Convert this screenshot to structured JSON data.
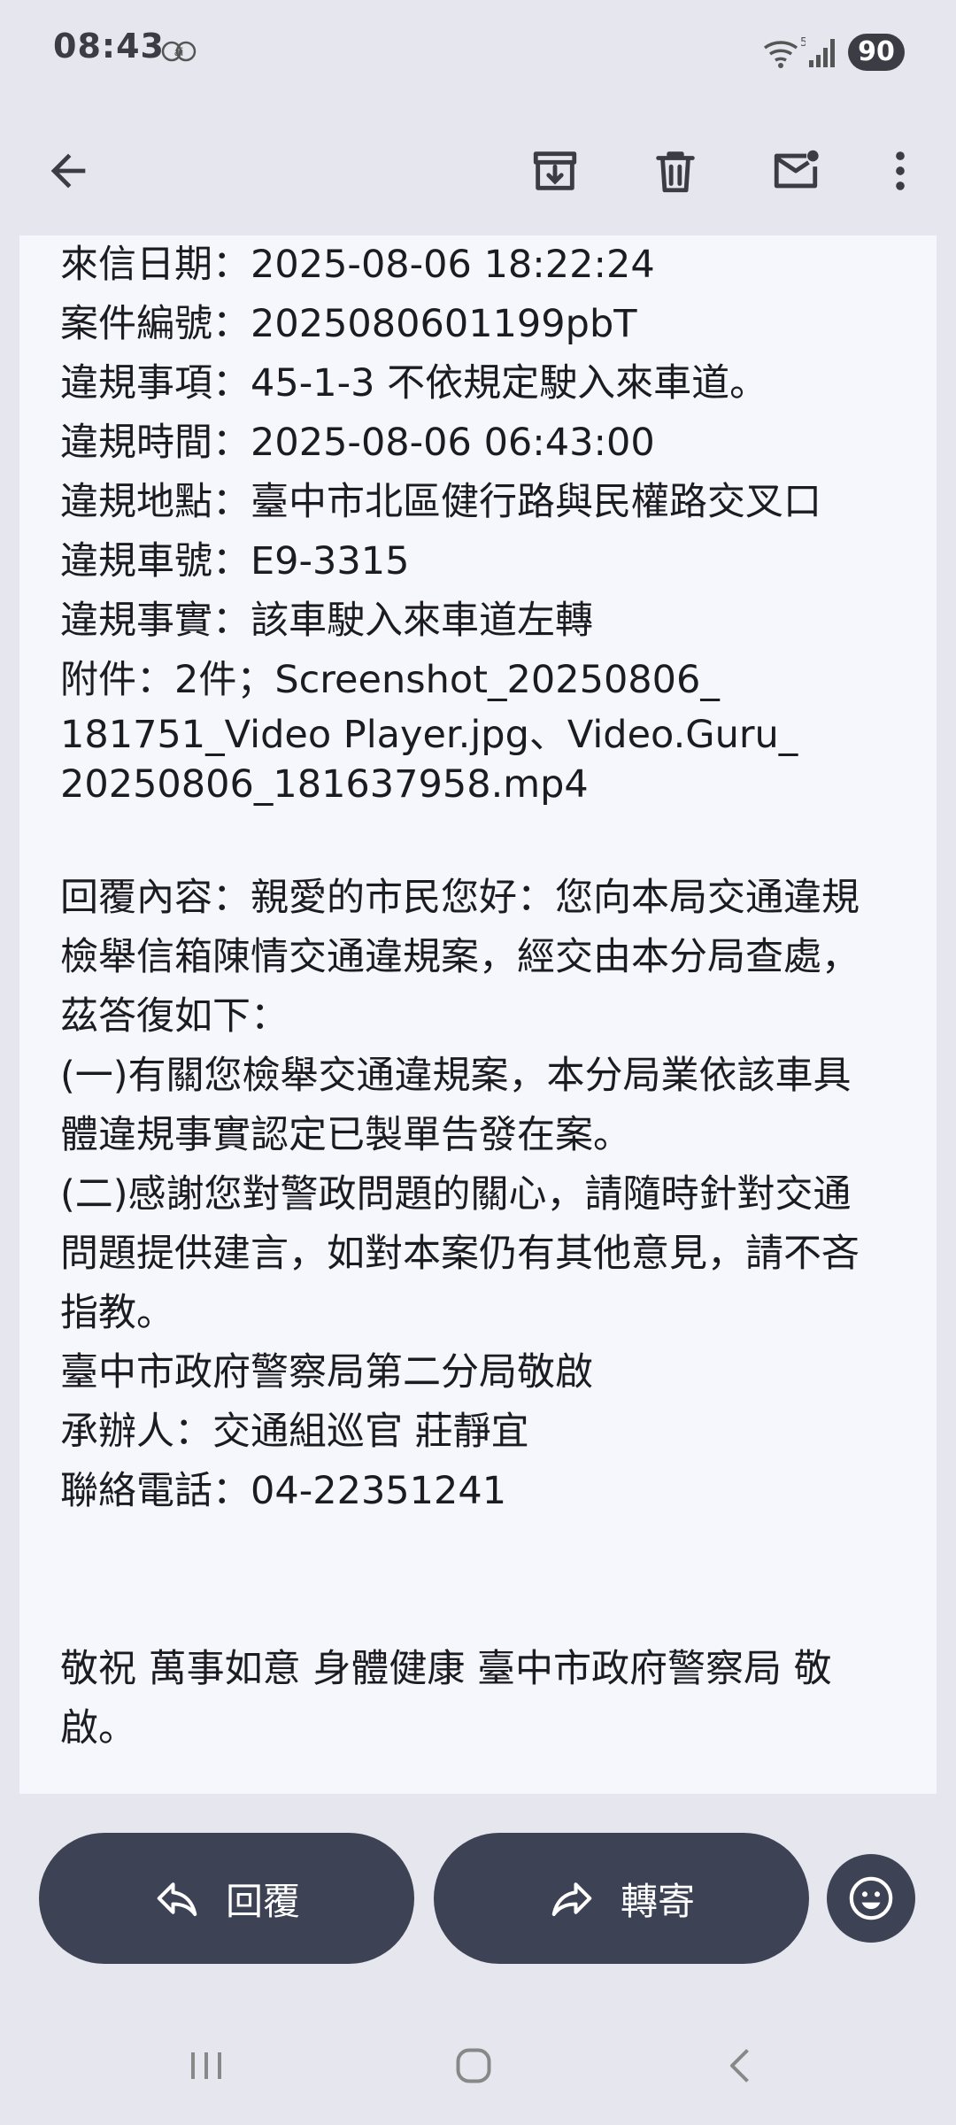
{
  "status": {
    "time": "08:43",
    "battery": "90",
    "wifi_badge": "5",
    "app_icon": "ai-icon"
  },
  "toolbar": {
    "back_icon": "back-arrow-icon",
    "archive_icon": "archive-icon",
    "delete_icon": "delete-icon",
    "mark_unread_icon": "mark-unread-icon",
    "more_icon": "more-vert-icon"
  },
  "email": {
    "meta": [
      "來信日期：2025-08-06 18:22:24",
      "案件編號：2025080601199pbT",
      "違規事項：45-1-3 不依規定駛入來車道。",
      "違規時間：2025-08-06 06:43:00",
      "違規地點：臺中市北區健行路與民權路交叉口",
      "違規車號：E9-3315",
      "違規事實：該車駛入來車道左轉",
      "附件：2件；Screenshot_20250806_"
    ],
    "attachment_continued": [
      "181751_Video Player.jpg、Video.Guru_",
      "20250806_181637958.mp4"
    ],
    "reply_body": [
      "回覆內容：親愛的市民您好：您向本局交通違規",
      "檢舉信箱陳情交通違規案，經交由本分局查處，",
      "茲答復如下：",
      "(一)有關您檢舉交通違規案，本分局業依該車具",
      "體違規事實認定已製單告發在案。",
      "(二)感謝您對警政問題的關心，請隨時針對交通",
      "問題提供建言，如對本案仍有其他意見，請不吝",
      "指教。",
      "臺中市政府警察局第二分局敬啟",
      "承辦人：交通組巡官 莊靜宜",
      "聯絡電話：04-22351241"
    ],
    "closing": [
      "敬祝 萬事如意 身體健康 臺中市政府警察局 敬",
      "啟。"
    ]
  },
  "actions": {
    "reply_label": "回覆",
    "forward_label": "轉寄",
    "emoji_icon": "emoji-reaction-icon"
  },
  "nav": {
    "recents_icon": "recents-icon",
    "home_icon": "home-icon",
    "back_icon": "nav-back-icon"
  }
}
